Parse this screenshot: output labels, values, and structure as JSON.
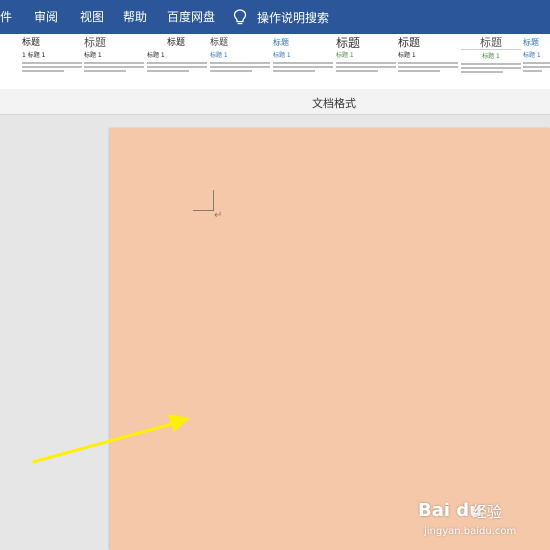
{
  "ribbon": {
    "tabs": [
      "件",
      "审阅",
      "视图",
      "帮助",
      "百度网盘"
    ],
    "tell_me": "操作说明搜索",
    "accent": "#2b579a"
  },
  "style_gallery": {
    "items": [
      {
        "title": "标题",
        "subtitle": "1 标题 1"
      },
      {
        "title": "标题",
        "subtitle": "标题 1"
      },
      {
        "title": "标题",
        "subtitle": "标题 1"
      },
      {
        "title": "标题",
        "subtitle": "标题 1"
      },
      {
        "title": "标题",
        "subtitle": "标题 1"
      },
      {
        "title": "标题",
        "subtitle": "标题 1"
      },
      {
        "title": "标题",
        "subtitle": "标题 1"
      },
      {
        "title": "标题",
        "subtitle": "标题 1"
      },
      {
        "title": "标题",
        "subtitle": "标题 1"
      }
    ],
    "group_label": "文档格式"
  },
  "document": {
    "page_color": "#f5c8aa",
    "paragraph_mark": "↵"
  },
  "annotation": {
    "arrow_color": "#ffef00"
  },
  "watermark": {
    "logo": "Bai du",
    "text": "经验",
    "url": "jingyan.baidu.com"
  }
}
